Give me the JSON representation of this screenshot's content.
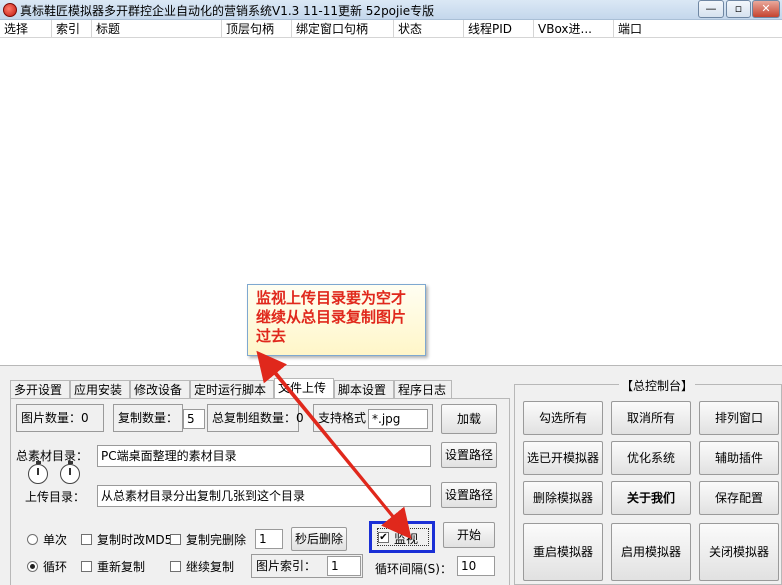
{
  "window": {
    "title": "真标鞋匠模拟器多开群控企业自动化的营销系统V1.3 11-11更新 52pojie专版"
  },
  "listview": {
    "columns": [
      "选择",
      "索引",
      "标题",
      "顶层句柄",
      "绑定窗口句柄",
      "状态",
      "线程PID",
      "VBox进...",
      "端口"
    ]
  },
  "tabs": [
    "多开设置",
    "应用安装",
    "修改设备",
    "定时运行脚本",
    "文件上传",
    "脚本设置",
    "程序日志"
  ],
  "upload": {
    "image_count_label": "图片数量：0",
    "copy_count_label": "复制数量：",
    "copy_count_value": "5",
    "total_groups_label": "总复制组数量：0",
    "format_label": "支持格式：",
    "format_value": "*.jpg",
    "load_button": "加载",
    "total_dir_label": "总素材目录：",
    "total_dir_value": "PC端桌面整理的素材目录",
    "set_path_button_1": "设置路径",
    "upload_dir_label": "上传目录：",
    "upload_dir_value": "从总素材目录分出复制几张到这个目录",
    "set_path_button_2": "设置路径",
    "single_label": "单次",
    "loop_label": "循环",
    "copy_md5_label": "复制时改MD5",
    "delete_after_copy_label": "复制完删除",
    "delete_seconds_value": "1",
    "delete_seconds_button": "秒后删除",
    "recopy_label": "重新复制",
    "continue_copy_label": "继续复制",
    "image_index_label": "图片索引：",
    "image_index_value": "1",
    "monitor_label": "监视",
    "start_button": "开始",
    "interval_label": "循环间隔(S)：",
    "interval_value": "10"
  },
  "callout": {
    "text": "监视上传目录要为空才继续从总目录复制图片过去"
  },
  "console": {
    "title": "【总控制台】",
    "buttons": [
      "勾选所有",
      "取消所有",
      "排列窗口",
      "选已开模拟器",
      "优化系统",
      "辅助插件",
      "删除模拟器",
      "关于我们",
      "保存配置",
      "重启模拟器",
      "启用模拟器",
      "关闭模拟器"
    ]
  },
  "colors": {
    "callout_text": "#e0281c",
    "arrow": "#e0281c",
    "highlight_box": "#1a2fd6"
  }
}
